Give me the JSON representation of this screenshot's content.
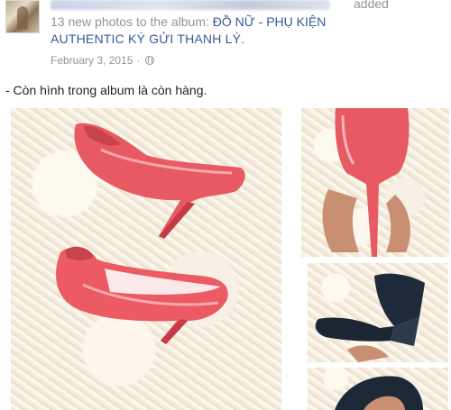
{
  "post": {
    "author_blurred": "Mylinemshop - Thanh lý đồ thời trang",
    "action_tail": "added",
    "action_text": "13 new photos to the album:",
    "album_name_part1": "ĐỒ NỮ - PHỤ KIỆN",
    "album_name_part2": "AUTHENTIC KÝ GỬI THANH LÝ.",
    "date": "February 3, 2015",
    "separator": "·",
    "privacy_icon": "globe-icon",
    "status_text": "- Còn hình trong album là còn hàng."
  },
  "photos": [
    {
      "subject": "pink-patent-heels"
    },
    {
      "subject": "pink-heel-held"
    },
    {
      "subject": "black-wedge"
    },
    {
      "subject": "black-shoe-partial"
    }
  ],
  "colors": {
    "link": "#365899",
    "meta": "#90949c",
    "text": "#1d2129",
    "shoe_pink": "#ec5a63"
  }
}
